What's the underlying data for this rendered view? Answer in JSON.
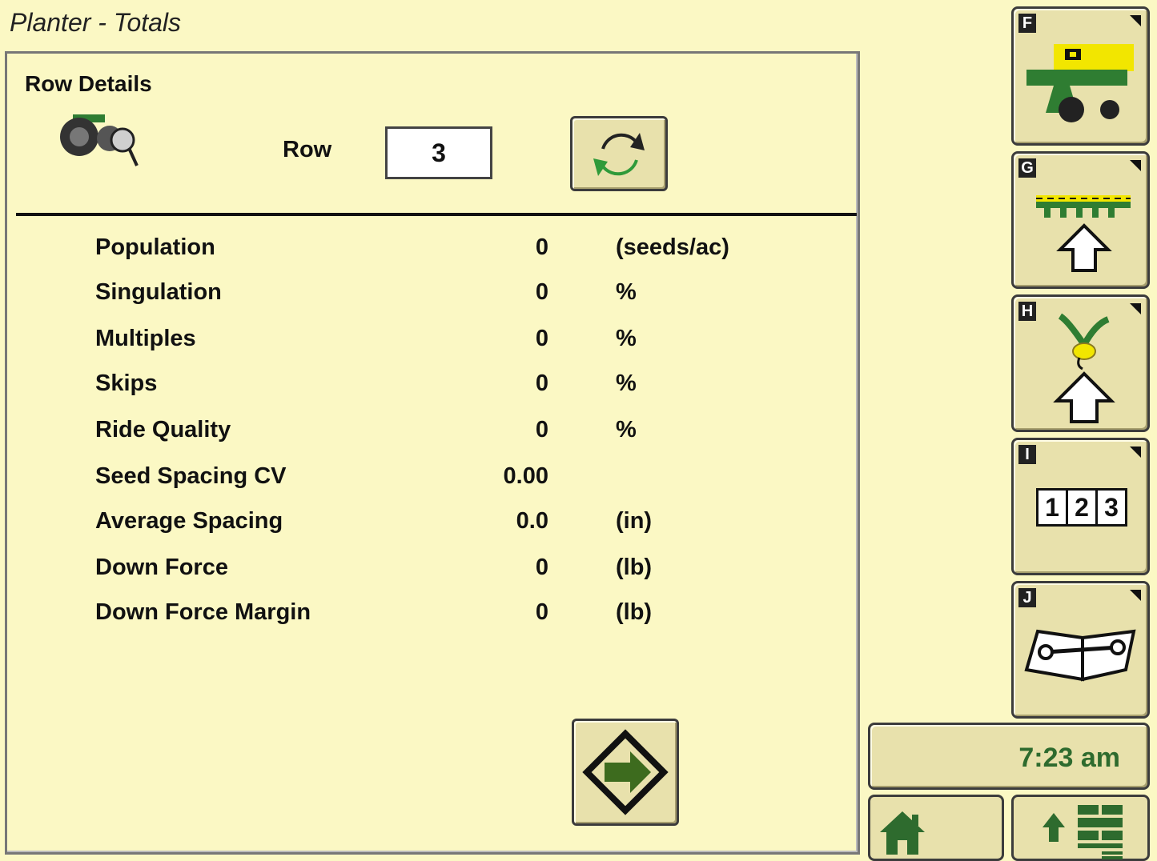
{
  "header": {
    "title": "Planter - Totals"
  },
  "row_details": {
    "title": "Row Details",
    "row_label": "Row",
    "row_value": "3"
  },
  "metrics": [
    {
      "label": "Population",
      "value": "0",
      "unit": "(seeds/ac)"
    },
    {
      "label": "Singulation",
      "value": "0",
      "unit": "%"
    },
    {
      "label": "Multiples",
      "value": "0",
      "unit": "%"
    },
    {
      "label": "Skips",
      "value": "0",
      "unit": "%"
    },
    {
      "label": "Ride Quality",
      "value": "0",
      "unit": "%"
    },
    {
      "label": "Seed Spacing CV",
      "value": "0.00",
      "unit": ""
    },
    {
      "label": "Average Spacing",
      "value": "0.0",
      "unit": "(in)"
    },
    {
      "label": "Down Force",
      "value": "0",
      "unit": "(lb)"
    },
    {
      "label": "Down Force Margin",
      "value": "0",
      "unit": "(lb)"
    }
  ],
  "side_menu": {
    "items": [
      {
        "letter": "F",
        "icon": "planter-icon"
      },
      {
        "letter": "G",
        "icon": "toolbar-up-icon"
      },
      {
        "letter": "H",
        "icon": "seed-up-icon"
      },
      {
        "letter": "I",
        "icon": "numbers-123-icon",
        "digits": [
          "1",
          "2",
          "3"
        ]
      },
      {
        "letter": "J",
        "icon": "book-wrench-icon"
      }
    ]
  },
  "status": {
    "time": "7:23 am"
  },
  "colors": {
    "background": "#fbf8c4",
    "button": "#e8e1ac",
    "accent_green": "#2e6b2e",
    "jd_yellow": "#f2e600",
    "jd_green": "#2f7d32"
  }
}
